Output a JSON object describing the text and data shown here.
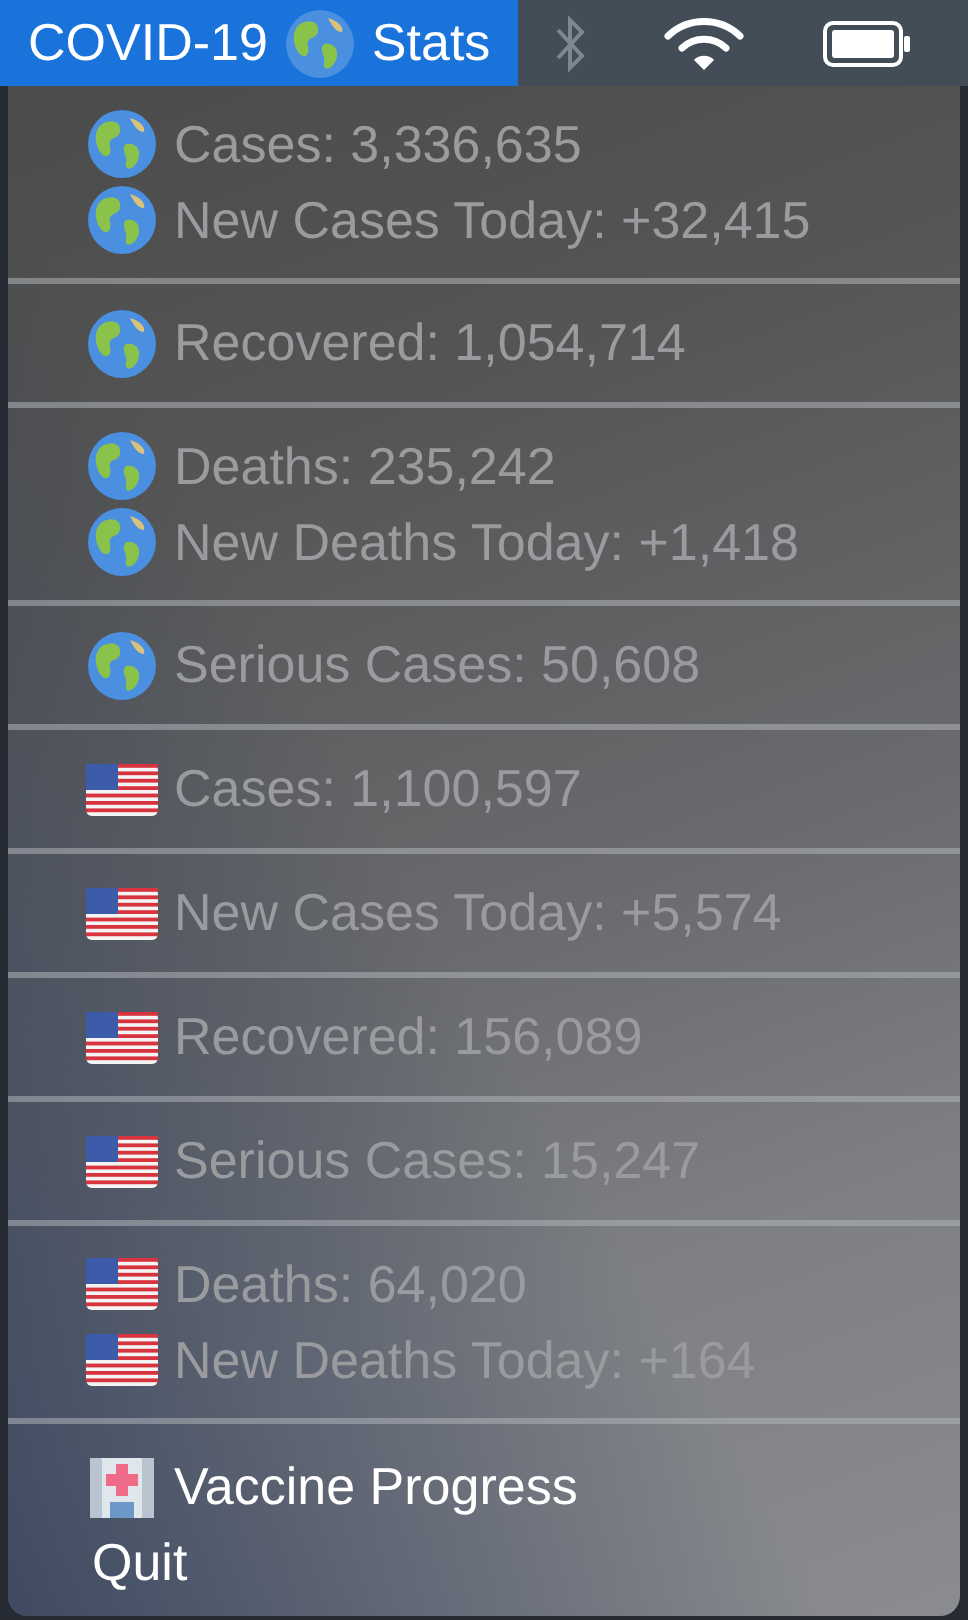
{
  "menu_bar": {
    "app_item": {
      "text_before": "COVID-19",
      "text_after": "Stats",
      "selected": true
    }
  },
  "menu": {
    "groups": [
      {
        "items": [
          {
            "kind": "globe",
            "label": "Cases: 3,336,635",
            "disabled": true
          },
          {
            "kind": "globe",
            "label": "New Cases Today: +32,415",
            "disabled": true
          }
        ]
      },
      {
        "items": [
          {
            "kind": "globe",
            "label": "Recovered: 1,054,714",
            "disabled": true
          }
        ]
      },
      {
        "items": [
          {
            "kind": "globe",
            "label": "Deaths: 235,242",
            "disabled": true
          },
          {
            "kind": "globe",
            "label": "New Deaths Today: +1,418",
            "disabled": true
          }
        ]
      },
      {
        "items": [
          {
            "kind": "globe",
            "label": "Serious Cases: 50,608",
            "disabled": true
          }
        ]
      },
      {
        "items": [
          {
            "kind": "flag",
            "label": "Cases: 1,100,597",
            "disabled": true
          }
        ]
      },
      {
        "items": [
          {
            "kind": "flag",
            "label": "New Cases Today: +5,574",
            "disabled": true
          }
        ]
      },
      {
        "items": [
          {
            "kind": "flag",
            "label": "Recovered: 156,089",
            "disabled": true
          }
        ]
      },
      {
        "items": [
          {
            "kind": "flag",
            "label": "Serious Cases: 15,247",
            "disabled": true
          }
        ]
      },
      {
        "items": [
          {
            "kind": "flag",
            "label": "Deaths: 64,020",
            "disabled": true
          },
          {
            "kind": "flag",
            "label": "New Deaths Today: +164",
            "disabled": true
          }
        ]
      },
      {
        "items": [
          {
            "kind": "hospital",
            "label": "Vaccine Progress",
            "disabled": false
          },
          {
            "kind": "plain",
            "label": "Quit",
            "disabled": false
          }
        ]
      }
    ]
  }
}
